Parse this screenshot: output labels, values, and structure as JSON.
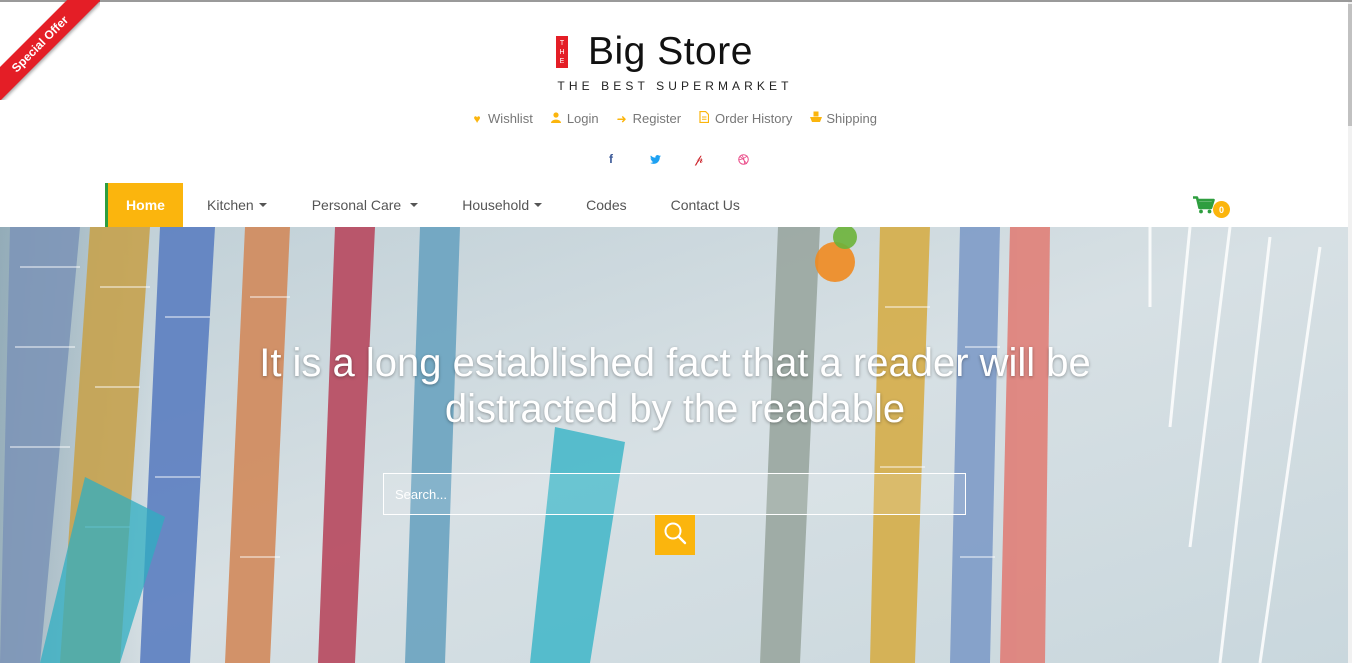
{
  "ribbon": {
    "label": "Special Offer"
  },
  "logo": {
    "tag_letters": [
      "T",
      "H",
      "E"
    ],
    "title": "Big Store",
    "tagline": "THE BEST SUPERMARKET"
  },
  "top_links": [
    {
      "icon": "heart-icon",
      "label": "Wishlist"
    },
    {
      "icon": "user-icon",
      "label": "Login"
    },
    {
      "icon": "arrow-right-icon",
      "label": "Register"
    },
    {
      "icon": "file-icon",
      "label": "Order History"
    },
    {
      "icon": "ship-icon",
      "label": "Shipping"
    }
  ],
  "social": [
    {
      "icon": "facebook-icon",
      "color": "#3b5998"
    },
    {
      "icon": "twitter-icon",
      "color": "#1da1f2"
    },
    {
      "icon": "pinterest-icon",
      "color": "#cb2027"
    },
    {
      "icon": "dribbble-icon",
      "color": "#ea4c89"
    }
  ],
  "nav": {
    "home": "Home",
    "kitchen": "Kitchen",
    "personal_care": "Personal Care",
    "household": "Household",
    "codes": "Codes",
    "contact": "Contact Us"
  },
  "cart": {
    "count": "0",
    "icon": "cart-icon",
    "icon_color": "#2e9e3f"
  },
  "hero": {
    "headline": "It is a long established fact that a reader will be distracted by the readable",
    "search_placeholder": "Search...",
    "search_icon": "search-icon"
  },
  "colors": {
    "accent": "#fbb50d",
    "brand_red": "#e41e26",
    "brand_green": "#2e9e3f"
  }
}
